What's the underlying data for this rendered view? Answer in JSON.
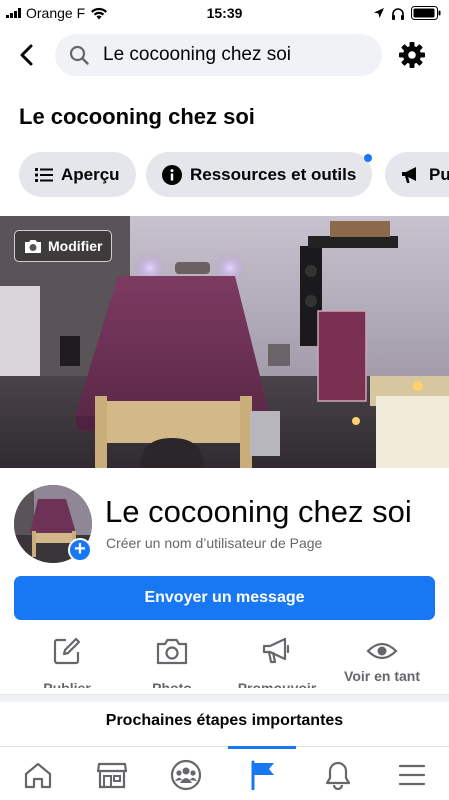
{
  "status_bar": {
    "carrier": "Orange F",
    "time": "15:39"
  },
  "search": {
    "query": "Le cocooning chez soi"
  },
  "page": {
    "title": "Le cocooning chez soi"
  },
  "tabs": [
    {
      "label": "Aperçu",
      "icon": "list-icon"
    },
    {
      "label": "Ressources et outils",
      "icon": "info-icon",
      "has_notification": true
    },
    {
      "label": "Pu",
      "icon": "megaphone-icon"
    }
  ],
  "cover": {
    "modify_label": "Modifier"
  },
  "profile": {
    "name": "Le cocooning chez soi",
    "username_prompt": "Créer un nom d’utilisateur de Page"
  },
  "send_message_label": "Envoyer un message",
  "actions": [
    {
      "label": "Publier",
      "icon": "edit-icon"
    },
    {
      "label": "Photo",
      "icon": "camera-icon"
    },
    {
      "label": "Promouvoir",
      "icon": "megaphone-icon"
    },
    {
      "label": "Voir en tant",
      "icon": "eye-icon"
    }
  ],
  "next_steps_label": "Prochaines étapes importantes",
  "bottom_nav": [
    {
      "name": "home-icon"
    },
    {
      "name": "marketplace-icon"
    },
    {
      "name": "groups-icon"
    },
    {
      "name": "pages-flag-icon",
      "active": true
    },
    {
      "name": "notifications-bell-icon"
    },
    {
      "name": "menu-icon"
    }
  ],
  "colors": {
    "accent": "#1877f2",
    "chip_bg": "#e4e6eb",
    "search_bg": "#f0f2f5",
    "secondary_text": "#65676b"
  }
}
